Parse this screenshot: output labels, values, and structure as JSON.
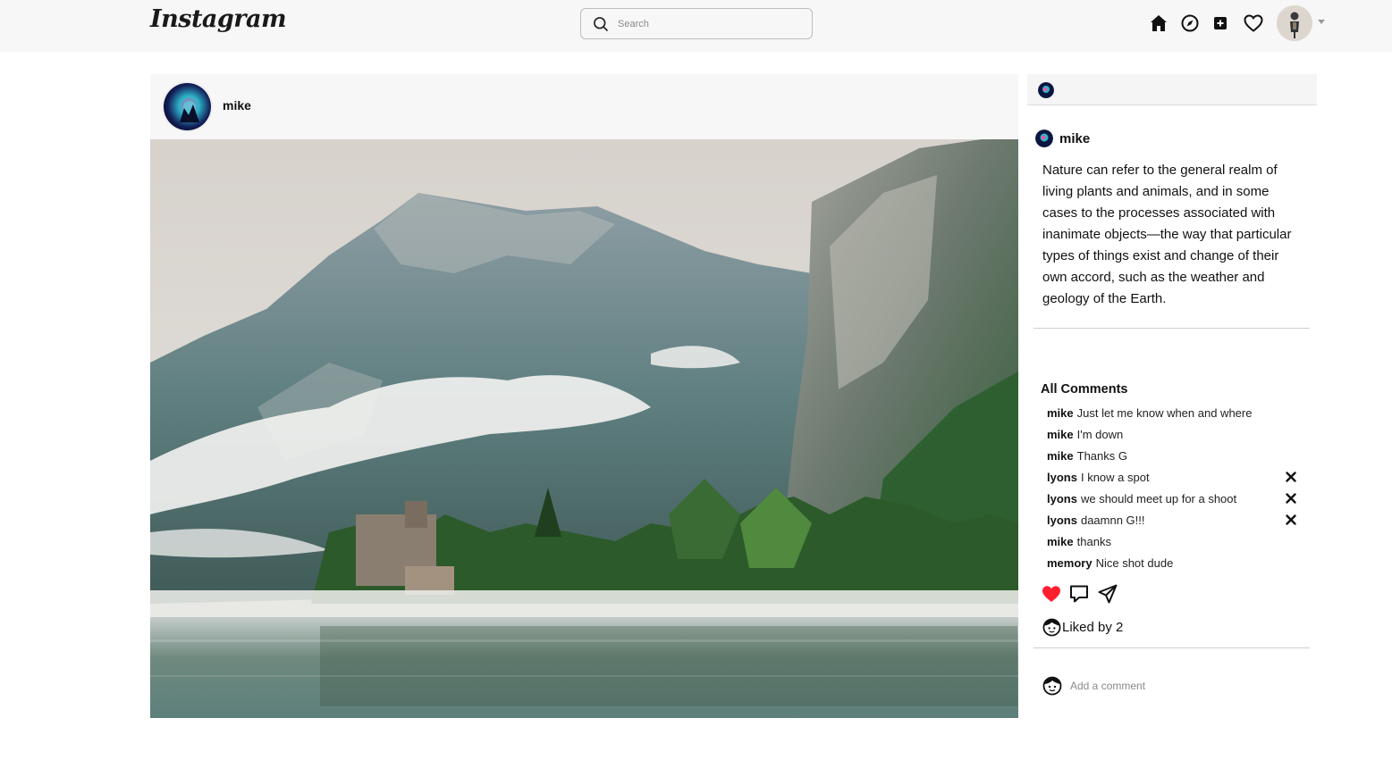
{
  "app": {
    "logo_text": "Instagram"
  },
  "search": {
    "placeholder": "Search"
  },
  "nav": {
    "icons": [
      "home-icon",
      "explore-compass-icon",
      "new-post-icon",
      "activity-heart-icon"
    ],
    "profile": "profile-avatar",
    "menu": "chevron-down-icon"
  },
  "post": {
    "username": "mike",
    "image_alt": "Misty mountain lake with castle"
  },
  "details": {
    "author": "mike",
    "caption": "Nature can refer to the general realm of living plants and animals, and in some cases to the processes associated with inanimate objects—the way that particular types of things exist and change of their own accord, such as the weather and geology of the Earth.",
    "comments_title": "All Comments",
    "comments": [
      {
        "user": "mike",
        "text": "Just let me know when and where",
        "deletable": false
      },
      {
        "user": "mike",
        "text": "I'm down",
        "deletable": false
      },
      {
        "user": "mike",
        "text": "Thanks G",
        "deletable": false
      },
      {
        "user": "lyons",
        "text": "I know a spot",
        "deletable": true
      },
      {
        "user": "lyons",
        "text": "we should meet up for a shoot",
        "deletable": true
      },
      {
        "user": "lyons",
        "text": "daamnn G!!!",
        "deletable": true
      },
      {
        "user": "mike",
        "text": "thanks",
        "deletable": false
      },
      {
        "user": "memory",
        "text": "Nice shot dude",
        "deletable": false
      }
    ],
    "liked_by": "Liked by 2",
    "add_comment_placeholder": "Add a comment",
    "like_color": "#ff1f2e"
  }
}
